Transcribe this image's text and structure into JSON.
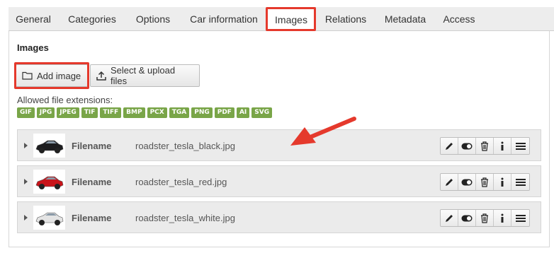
{
  "tabs": [
    {
      "label": "General"
    },
    {
      "label": "Categories"
    },
    {
      "label": "Options"
    },
    {
      "label": "Car information"
    },
    {
      "label": "Images"
    },
    {
      "label": "Relations"
    },
    {
      "label": "Metadata"
    },
    {
      "label": "Access"
    }
  ],
  "active_tab": "Images",
  "section": {
    "title": "Images"
  },
  "buttons": {
    "add_image": "Add image",
    "select_upload": "Select & upload files"
  },
  "extensions": {
    "label": "Allowed file extensions:",
    "items": [
      "GIF",
      "JPG",
      "JPEG",
      "TIF",
      "TIFF",
      "BMP",
      "PCX",
      "TGA",
      "PNG",
      "PDF",
      "AI",
      "SVG"
    ]
  },
  "files": [
    {
      "label": "Filename",
      "value": "roadster_tesla_black.jpg",
      "car_color": "#1d1d1f"
    },
    {
      "label": "Filename",
      "value": "roadster_tesla_red.jpg",
      "car_color": "#c8141a"
    },
    {
      "label": "Filename",
      "value": "roadster_tesla_white.jpg",
      "car_color": "#e4e4e4"
    }
  ],
  "colors": {
    "highlight": "#e5392c",
    "badge": "#79a548"
  },
  "icons": [
    "folder-icon",
    "upload-icon",
    "pencil-icon",
    "toggle-icon",
    "trash-icon",
    "info-icon",
    "menu-icon",
    "caret-right-icon",
    "arrow-annotation"
  ]
}
